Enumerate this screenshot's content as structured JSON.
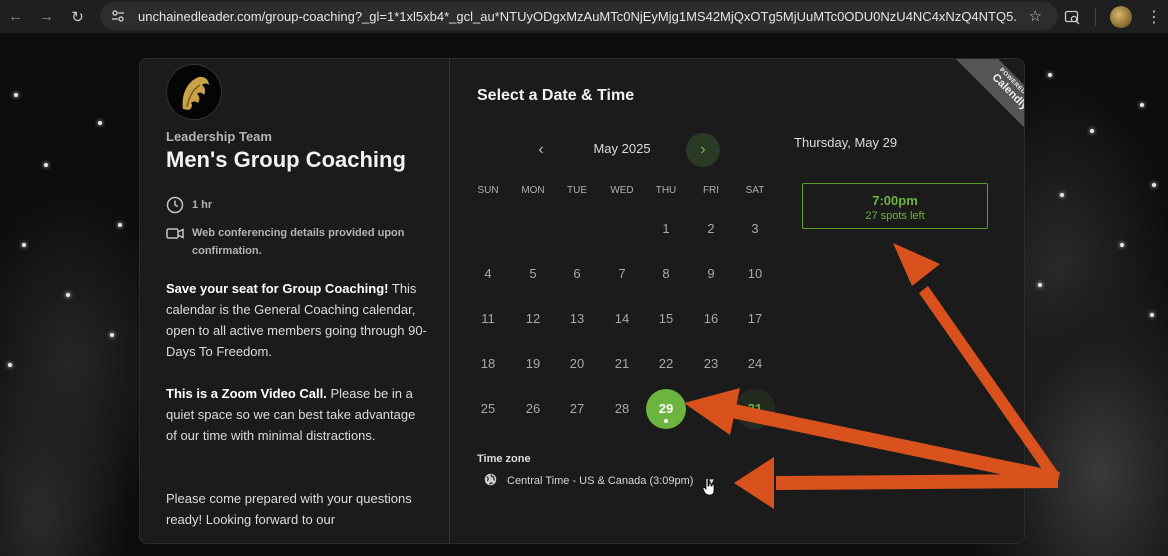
{
  "browser": {
    "url": "unchainedleader.com/group-coaching?_gl=1*1xl5xb4*_gcl_au*NTUyODgxMzAuMTc0NjEyMjg1MS42MjQxOTg5MjUuMTc0ODU0NzU4NC4xNzQ4NTQ5...",
    "back_icon": "←",
    "forward_icon": "→",
    "reload_icon": "↻",
    "star_icon": "☆",
    "menu_icon": "⋮"
  },
  "host_panel": {
    "host_name": "Leadership Team",
    "event_title": "Men's Group Coaching",
    "duration": "1 hr",
    "conferencing": "Web conferencing details provided upon confirmation.",
    "desc1_bold": "Save your seat for Group Coaching!",
    "desc1_rest": " This calendar is the General Coaching calendar, open to all active members going through 90-Days To Freedom.",
    "desc2_bold": "This is a Zoom Video Call.",
    "desc2_rest": " Please be in a quiet space so we can best take advantage of our time with minimal distractions.",
    "desc3": "Please come prepared with your questions ready! Looking forward to our"
  },
  "calendar": {
    "heading": "Select a Date & Time",
    "month_label": "May 2025",
    "prev_icon": "‹",
    "next_icon": "›",
    "weekdays": [
      "SUN",
      "MON",
      "TUE",
      "WED",
      "THU",
      "FRI",
      "SAT"
    ],
    "days": [
      {
        "label": "1",
        "col": 4,
        "row": 0
      },
      {
        "label": "2",
        "col": 5,
        "row": 0
      },
      {
        "label": "3",
        "col": 6,
        "row": 0
      },
      {
        "label": "4",
        "col": 0,
        "row": 1
      },
      {
        "label": "5",
        "col": 1,
        "row": 1
      },
      {
        "label": "6",
        "col": 2,
        "row": 1
      },
      {
        "label": "7",
        "col": 3,
        "row": 1
      },
      {
        "label": "8",
        "col": 4,
        "row": 1
      },
      {
        "label": "9",
        "col": 5,
        "row": 1
      },
      {
        "label": "10",
        "col": 6,
        "row": 1
      },
      {
        "label": "11",
        "col": 0,
        "row": 2
      },
      {
        "label": "12",
        "col": 1,
        "row": 2
      },
      {
        "label": "13",
        "col": 2,
        "row": 2
      },
      {
        "label": "14",
        "col": 3,
        "row": 2
      },
      {
        "label": "15",
        "col": 4,
        "row": 2
      },
      {
        "label": "16",
        "col": 5,
        "row": 2
      },
      {
        "label": "17",
        "col": 6,
        "row": 2
      },
      {
        "label": "18",
        "col": 0,
        "row": 3
      },
      {
        "label": "19",
        "col": 1,
        "row": 3
      },
      {
        "label": "20",
        "col": 2,
        "row": 3
      },
      {
        "label": "21",
        "col": 3,
        "row": 3
      },
      {
        "label": "22",
        "col": 4,
        "row": 3
      },
      {
        "label": "23",
        "col": 5,
        "row": 3
      },
      {
        "label": "24",
        "col": 6,
        "row": 3
      },
      {
        "label": "25",
        "col": 0,
        "row": 4
      },
      {
        "label": "26",
        "col": 1,
        "row": 4
      },
      {
        "label": "27",
        "col": 2,
        "row": 4
      },
      {
        "label": "28",
        "col": 3,
        "row": 4
      },
      {
        "label": "29",
        "col": 4,
        "row": 4,
        "state": "selected"
      },
      {
        "label": "30",
        "col": 5,
        "row": 4
      },
      {
        "label": "31",
        "col": 6,
        "row": 4,
        "state": "available"
      }
    ],
    "timezone_label": "Time zone",
    "timezone_value": "Central Time - US & Canada (3:09pm)",
    "timezone_icon": "globe-icon"
  },
  "slots": {
    "date_heading": "Thursday, May 29",
    "items": [
      {
        "time": "7:00pm",
        "spots": "27 spots left"
      }
    ]
  },
  "ribbon": {
    "powered_by": "POWERED BY",
    "brand": "Calendly"
  },
  "colors": {
    "accent": "#6cb33f",
    "annotation_arrow": "#d9521d",
    "card_bg": "#1b1b1b"
  }
}
